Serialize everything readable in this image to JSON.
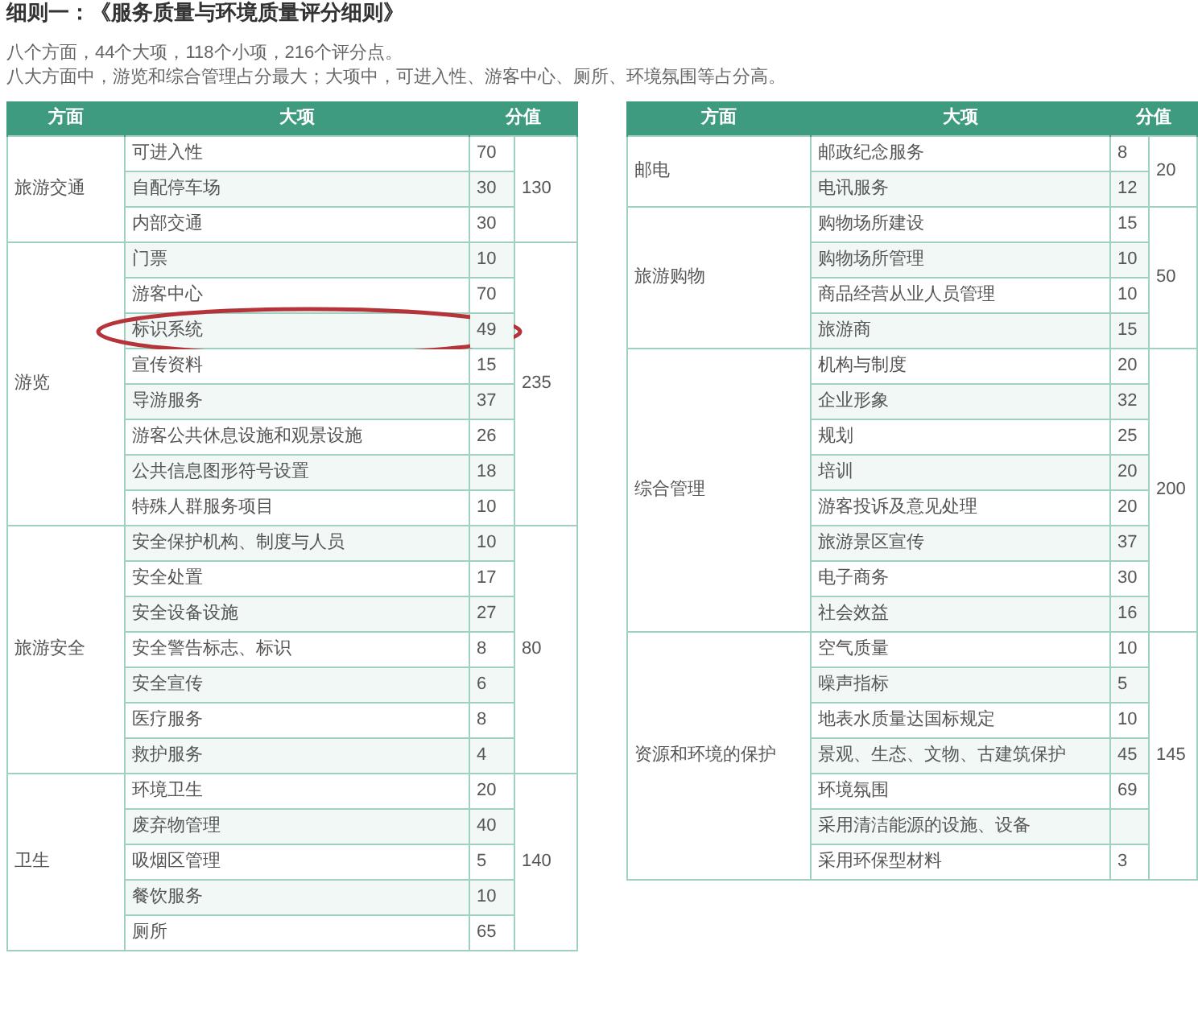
{
  "title": "细则一：《服务质量与环境质量评分细则》",
  "summary": [
    "八个方面，44个大项，118个小项，216个评分点。",
    "八大方面中，游览和综合管理占分最大；大项中，可进入性、游客中心、厕所、环境氛围等占分高。"
  ],
  "tables": [
    {
      "columns": [
        "方面",
        "大项",
        "分值"
      ],
      "groups": [
        {
          "aspect": "旅游交通",
          "total": "130",
          "items": [
            {
              "name": "可进入性",
              "score": "70",
              "circled": false
            },
            {
              "name": "自配停车场",
              "score": "30",
              "circled": false
            },
            {
              "name": "内部交通",
              "score": "30",
              "circled": false
            }
          ]
        },
        {
          "aspect": "游览",
          "total": "235",
          "items": [
            {
              "name": "门票",
              "score": "10",
              "circled": false
            },
            {
              "name": "游客中心",
              "score": "70",
              "circled": false
            },
            {
              "name": "标识系统",
              "score": "49",
              "circled": true
            },
            {
              "name": "宣传资料",
              "score": "15",
              "circled": false
            },
            {
              "name": "导游服务",
              "score": "37",
              "circled": false
            },
            {
              "name": "游客公共休息设施和观景设施",
              "score": "26",
              "circled": false
            },
            {
              "name": "公共信息图形符号设置",
              "score": "18",
              "circled": false
            },
            {
              "name": "特殊人群服务项目",
              "score": "10",
              "circled": false
            }
          ]
        },
        {
          "aspect": "旅游安全",
          "total": "80",
          "items": [
            {
              "name": "安全保护机构、制度与人员",
              "score": "10",
              "circled": false
            },
            {
              "name": "安全处置",
              "score": "17",
              "circled": false
            },
            {
              "name": "安全设备设施",
              "score": "27",
              "circled": false
            },
            {
              "name": "安全警告标志、标识",
              "score": "8",
              "circled": false
            },
            {
              "name": "安全宣传",
              "score": "6",
              "circled": false
            },
            {
              "name": "医疗服务",
              "score": "8",
              "circled": false
            },
            {
              "name": "救护服务",
              "score": "4",
              "circled": false
            }
          ]
        },
        {
          "aspect": "卫生",
          "total": "140",
          "items": [
            {
              "name": "环境卫生",
              "score": "20",
              "circled": false
            },
            {
              "name": "废弃物管理",
              "score": "40",
              "circled": false
            },
            {
              "name": "吸烟区管理",
              "score": "5",
              "circled": false
            },
            {
              "name": "餐饮服务",
              "score": "10",
              "circled": false
            },
            {
              "name": "厕所",
              "score": "65",
              "circled": false
            }
          ]
        }
      ]
    },
    {
      "columns": [
        "方面",
        "大项",
        "分值"
      ],
      "groups": [
        {
          "aspect": "邮电",
          "total": "20",
          "items": [
            {
              "name": "邮政纪念服务",
              "score": "8",
              "circled": false
            },
            {
              "name": "电讯服务",
              "score": "12",
              "circled": false
            }
          ]
        },
        {
          "aspect": "旅游购物",
          "total": "50",
          "items": [
            {
              "name": "购物场所建设",
              "score": "15",
              "circled": false
            },
            {
              "name": "购物场所管理",
              "score": "10",
              "circled": false
            },
            {
              "name": "商品经营从业人员管理",
              "score": "10",
              "circled": false
            },
            {
              "name": "旅游商",
              "score": "15",
              "circled": false
            }
          ]
        },
        {
          "aspect": "综合管理",
          "total": "200",
          "items": [
            {
              "name": "机构与制度",
              "score": "20",
              "circled": false
            },
            {
              "name": "企业形象",
              "score": "32",
              "circled": false
            },
            {
              "name": "规划",
              "score": "25",
              "circled": false
            },
            {
              "name": "培训",
              "score": "20",
              "circled": false
            },
            {
              "name": "游客投诉及意见处理",
              "score": "20",
              "circled": false
            },
            {
              "name": "旅游景区宣传",
              "score": "37",
              "circled": false
            },
            {
              "name": "电子商务",
              "score": "30",
              "circled": false
            },
            {
              "name": "社会效益",
              "score": "16",
              "circled": false
            }
          ]
        },
        {
          "aspect": "资源和环境的保护",
          "total": "145",
          "items": [
            {
              "name": "空气质量",
              "score": "10",
              "circled": false
            },
            {
              "name": "噪声指标",
              "score": "5",
              "circled": false
            },
            {
              "name": "地表水质量达国标规定",
              "score": "10",
              "circled": false
            },
            {
              "name": "景观、生态、文物、古建筑保护",
              "score": "45",
              "circled": false
            },
            {
              "name": "环境氛围",
              "score": "69",
              "circled": false
            },
            {
              "name": "采用清洁能源的设施、设备",
              "circled": false
            },
            {
              "name": "采用环保型材料",
              "score": "3",
              "circled": false
            }
          ]
        }
      ]
    }
  ]
}
